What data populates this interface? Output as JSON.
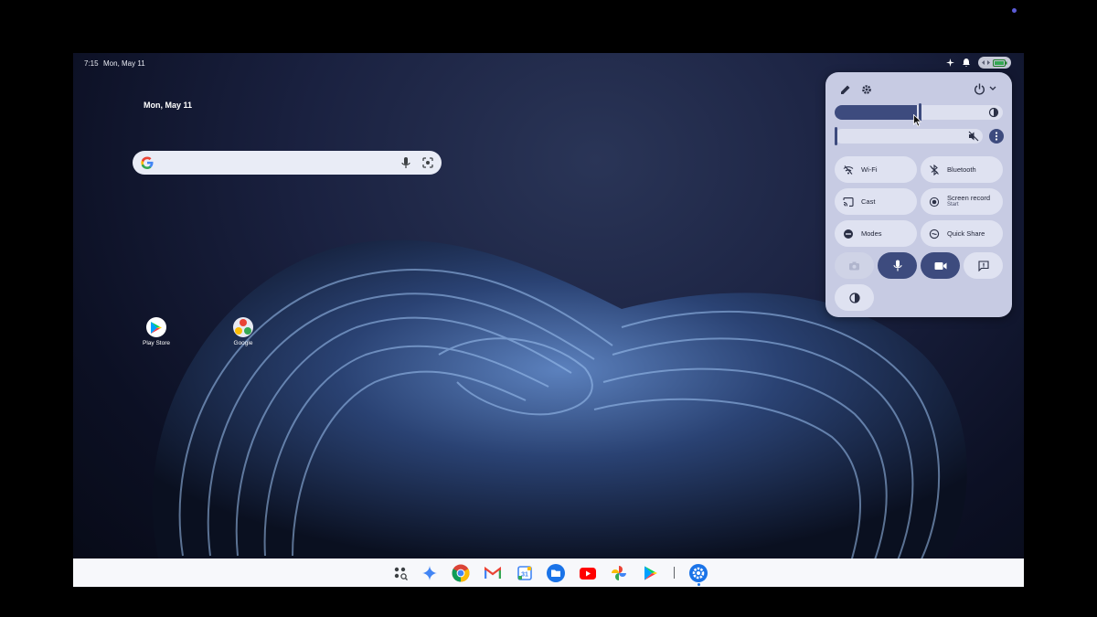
{
  "status_bar": {
    "time": "7:15",
    "date": "Mon, May 11"
  },
  "widget": {
    "date": "Mon, May 11"
  },
  "desktop_icons": [
    {
      "label": "Play Store",
      "icon": "play-store-icon"
    },
    {
      "label": "Google",
      "icon": "google-folder-icon"
    }
  ],
  "quick_settings": {
    "brightness_level": 0.5,
    "volume_level": 0.0,
    "tiles": [
      {
        "label": "Wi-Fi",
        "icon": "wifi-off-icon"
      },
      {
        "label": "Bluetooth",
        "icon": "bluetooth-off-icon"
      },
      {
        "label": "Cast",
        "icon": "cast-icon"
      },
      {
        "label": "Screen record",
        "sublabel": "Start",
        "icon": "screen-record-icon"
      },
      {
        "label": "Modes",
        "icon": "modes-icon"
      },
      {
        "label": "Quick Share",
        "icon": "quick-share-icon"
      }
    ],
    "small_tiles": [
      {
        "name": "camera-toggle",
        "state": "disabled"
      },
      {
        "name": "microphone-toggle",
        "state": "on"
      },
      {
        "name": "video-toggle",
        "state": "on"
      },
      {
        "name": "caption-toggle",
        "state": "off"
      },
      {
        "name": "contrast-toggle",
        "state": "off"
      }
    ]
  },
  "shelf_apps": [
    "launcher-icon",
    "gemini-icon",
    "chrome-icon",
    "gmail-icon",
    "calendar-icon",
    "files-icon",
    "youtube-icon",
    "photos-icon",
    "play-store-icon",
    "settings-icon"
  ],
  "colors": {
    "panel": "#c7cbe3",
    "accent": "#3d4b7e",
    "tile": "#dfe2f1"
  }
}
